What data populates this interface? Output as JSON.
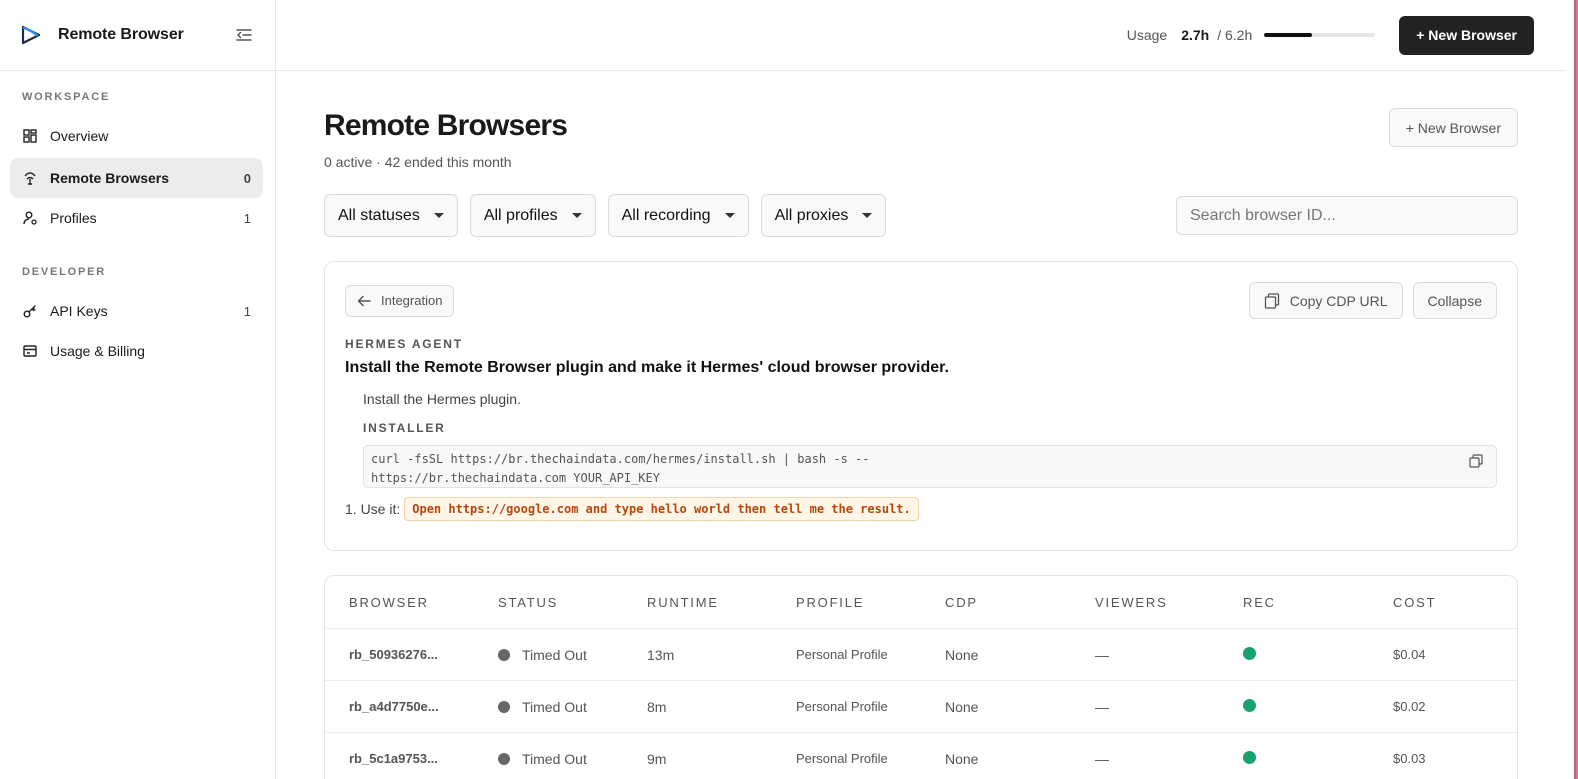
{
  "sidebar": {
    "app_name": "Remote Browser",
    "sections": {
      "workspace": "WORKSPACE",
      "developer": "DEVELOPER"
    },
    "items": [
      {
        "label": "Overview",
        "count": ""
      },
      {
        "label": "Remote Browsers",
        "count": "0"
      },
      {
        "label": "Profiles",
        "count": "1"
      },
      {
        "label": "API Keys",
        "count": "1"
      },
      {
        "label": "Usage & Billing",
        "count": ""
      }
    ]
  },
  "topbar": {
    "usage_label": "Usage",
    "usage_value": "2.7h",
    "usage_total": "/ 6.2h",
    "usage_fraction": 0.43,
    "new_browser_label": "+ New Browser"
  },
  "page": {
    "title": "Remote Browsers",
    "subtitle": "0 active · 42 ended this month",
    "new_browser_label": "+ New Browser"
  },
  "filters": {
    "statuses": "All statuses",
    "profiles": "All profiles",
    "recording": "All recording",
    "proxies": "All proxies",
    "search_placeholder": "Search browser ID..."
  },
  "integration": {
    "back_label": "Integration",
    "copy_cdp_label": "Copy CDP URL",
    "collapse_label": "Collapse",
    "eyebrow": "HERMES AGENT",
    "title": "Install the Remote Browser plugin and make it Hermes' cloud browser provider.",
    "step_text": "Install the Hermes plugin.",
    "installer_label": "INSTALLER",
    "code_line1": "curl -fsSL https://br.thechaindata.com/hermes/install.sh | bash -s --",
    "code_line2": "https://br.thechaindata.com YOUR_API_KEY",
    "use_prefix": "1. Use it:",
    "use_code": "Open https://google.com and type hello world then tell me the result."
  },
  "table": {
    "headers": [
      "BROWSER",
      "STATUS",
      "RUNTIME",
      "PROFILE",
      "CDP",
      "VIEWERS",
      "REC",
      "COST"
    ],
    "rows": [
      {
        "id": "rb_50936276...",
        "status": "Timed Out",
        "runtime": "13m",
        "profile": "Personal Profile",
        "cdp": "None",
        "viewers": "—",
        "cost": "$0.04"
      },
      {
        "id": "rb_a4d7750e...",
        "status": "Timed Out",
        "runtime": "8m",
        "profile": "Personal Profile",
        "cdp": "None",
        "viewers": "—",
        "cost": "$0.02"
      },
      {
        "id": "rb_5c1a9753...",
        "status": "Timed Out",
        "runtime": "9m",
        "profile": "Personal Profile",
        "cdp": "None",
        "viewers": "—",
        "cost": "$0.03"
      }
    ]
  },
  "colors": {
    "accent_dark": "#222222",
    "status_green": "#18a36c",
    "status_gray": "#666666",
    "code_accent": "#b8460d"
  }
}
